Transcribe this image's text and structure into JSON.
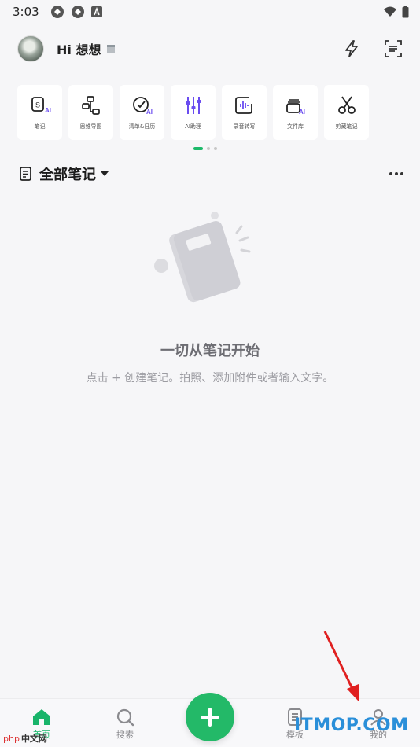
{
  "status_bar": {
    "time": "3:03"
  },
  "header": {
    "greeting": "Hi 想想"
  },
  "tools": [
    {
      "label": "笔记",
      "icon": "ai-note-icon"
    },
    {
      "label": "思维导图",
      "icon": "mindmap-icon"
    },
    {
      "label": "清单&日历",
      "icon": "ai-checklist-icon"
    },
    {
      "label": "AI助理",
      "icon": "ai-assistant-icon"
    },
    {
      "label": "录音转写",
      "icon": "voice-record-icon"
    },
    {
      "label": "文件库",
      "icon": "ai-file-library-icon"
    },
    {
      "label": "剪藏笔记",
      "icon": "scissors-icon"
    }
  ],
  "section": {
    "title": "全部笔记"
  },
  "empty_state": {
    "title": "一切从笔记开始",
    "subtitle": "点击 + 创建笔记。拍照、添加附件或者输入文字。"
  },
  "bottom_nav": [
    {
      "label": "首页",
      "icon": "home-icon",
      "active": true
    },
    {
      "label": "搜索",
      "icon": "search-icon",
      "active": false
    },
    {
      "label": "模板",
      "icon": "template-icon",
      "active": false
    },
    {
      "label": "我的",
      "icon": "profile-icon",
      "active": false
    }
  ],
  "watermarks": {
    "left_php": "php",
    "left_site": "中文网",
    "right": "ITMOP.COM"
  },
  "colors": {
    "accent": "#23b968",
    "ai_purple": "#6a4cf0",
    "background": "#f6f6f8"
  }
}
